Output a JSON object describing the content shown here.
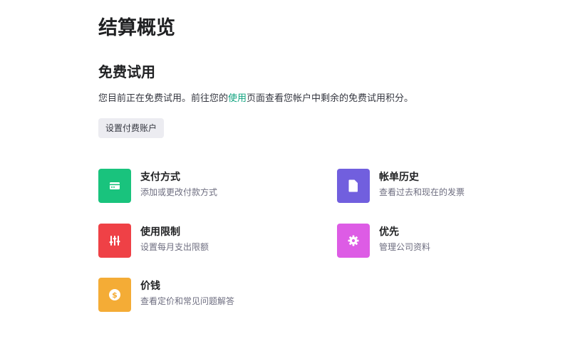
{
  "page": {
    "title": "结算概览"
  },
  "trial": {
    "heading": "免费试用",
    "desc_before": "您目前正在免费试用。前往您的",
    "desc_link": "使用",
    "desc_after": "页面查看您帐户中剩余的免费试用积分。",
    "setup_button": "设置付费账户"
  },
  "cards": {
    "payment": {
      "title": "支付方式",
      "subtitle": "添加或更改付款方式",
      "icon": "credit-card-icon",
      "color": "#19c37d"
    },
    "billing": {
      "title": "帐单历史",
      "subtitle": "查看过去和现在的发票",
      "icon": "document-icon",
      "color": "#715fde"
    },
    "limits": {
      "title": "使用限制",
      "subtitle": "设置每月支出限额",
      "icon": "sliders-icon",
      "color": "#ef4146"
    },
    "preferences": {
      "title": "优先",
      "subtitle": "管理公司资料",
      "icon": "gear-icon",
      "color": "#dd5ce5"
    },
    "pricing": {
      "title": "价钱",
      "subtitle": "查看定价和常见问题解答",
      "icon": "dollar-icon",
      "color": "#f4ac36"
    }
  }
}
